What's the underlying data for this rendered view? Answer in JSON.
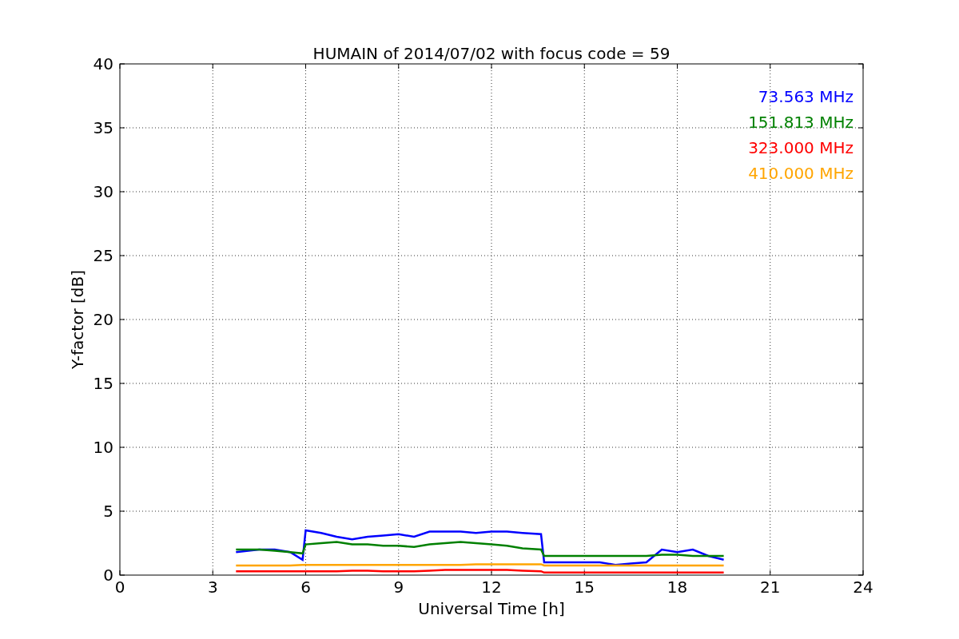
{
  "chart_data": {
    "type": "line",
    "title": "HUMAIN of 2014/07/02 with focus code = 59",
    "xlabel": "Universal Time [h]",
    "ylabel": "Y-factor [dB]",
    "x": [
      3.75,
      4.5,
      5,
      5.5,
      5.9,
      6,
      6.5,
      7,
      7.5,
      8,
      8.5,
      9,
      9.5,
      10,
      10.5,
      11,
      11.5,
      12,
      12.5,
      13,
      13.6,
      13.7,
      14.5,
      15,
      15.5,
      16,
      16.5,
      17,
      17.5,
      18,
      18.5,
      19,
      19.5
    ],
    "series": [
      {
        "name": "73.563 MHz",
        "color": "#0000ff",
        "values": [
          1.8,
          2.0,
          2.0,
          1.8,
          1.2,
          3.5,
          3.3,
          3.0,
          2.8,
          3.0,
          3.1,
          3.2,
          3.0,
          3.4,
          3.4,
          3.4,
          3.3,
          3.4,
          3.4,
          3.3,
          3.2,
          1.0,
          1.0,
          1.0,
          1.0,
          0.8,
          0.9,
          1.0,
          2.0,
          1.8,
          2.0,
          1.5,
          1.2
        ]
      },
      {
        "name": "151.813 MHz",
        "color": "#008000",
        "values": [
          2.0,
          2.0,
          1.9,
          1.8,
          1.7,
          2.4,
          2.5,
          2.6,
          2.4,
          2.4,
          2.3,
          2.3,
          2.2,
          2.4,
          2.5,
          2.6,
          2.5,
          2.4,
          2.3,
          2.1,
          2.0,
          1.5,
          1.5,
          1.5,
          1.5,
          1.5,
          1.5,
          1.5,
          1.6,
          1.6,
          1.5,
          1.5,
          1.5
        ]
      },
      {
        "name": "323.000 MHz",
        "color": "#ff0000",
        "values": [
          0.3,
          0.3,
          0.3,
          0.3,
          0.3,
          0.3,
          0.3,
          0.3,
          0.35,
          0.35,
          0.3,
          0.3,
          0.3,
          0.35,
          0.4,
          0.4,
          0.4,
          0.4,
          0.4,
          0.35,
          0.3,
          0.2,
          0.2,
          0.2,
          0.2,
          0.2,
          0.2,
          0.2,
          0.2,
          0.2,
          0.2,
          0.2,
          0.2
        ]
      },
      {
        "name": "410.000 MHz",
        "color": "#ffa500",
        "values": [
          0.75,
          0.75,
          0.75,
          0.75,
          0.8,
          0.8,
          0.8,
          0.8,
          0.8,
          0.8,
          0.8,
          0.8,
          0.8,
          0.8,
          0.8,
          0.8,
          0.85,
          0.85,
          0.85,
          0.85,
          0.85,
          0.75,
          0.75,
          0.75,
          0.75,
          0.75,
          0.75,
          0.75,
          0.75,
          0.75,
          0.75,
          0.75,
          0.75
        ]
      }
    ],
    "xlim": [
      0,
      24
    ],
    "ylim": [
      0,
      40
    ],
    "xticks": [
      0,
      3,
      6,
      9,
      12,
      15,
      18,
      21,
      24
    ],
    "yticks": [
      0,
      5,
      10,
      15,
      20,
      25,
      30,
      35,
      40
    ],
    "grid": true
  }
}
